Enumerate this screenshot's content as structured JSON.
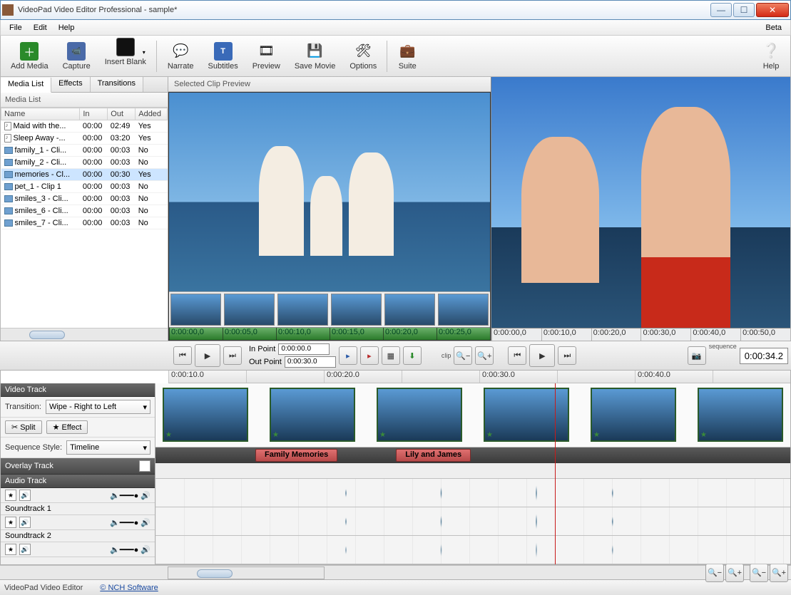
{
  "window": {
    "title": "VideoPad Video Editor Professional - sample*"
  },
  "menubar": {
    "file": "File",
    "edit": "Edit",
    "help": "Help",
    "beta": "Beta"
  },
  "toolbar": {
    "add_media": "Add Media",
    "capture": "Capture",
    "insert_blank": "Insert Blank",
    "narrate": "Narrate",
    "subtitles": "Subtitles",
    "preview": "Preview",
    "save_movie": "Save Movie",
    "options": "Options",
    "suite": "Suite",
    "help": "Help"
  },
  "tabs": {
    "media_list": "Media List",
    "effects": "Effects",
    "transitions": "Transitions"
  },
  "media_list": {
    "title": "Media List",
    "columns": {
      "name": "Name",
      "in": "In",
      "out": "Out",
      "added": "Added"
    },
    "rows": [
      {
        "type": "audio",
        "name": "Maid with the...",
        "in": "00:00",
        "out": "02:49",
        "added": "Yes"
      },
      {
        "type": "audio",
        "name": "Sleep Away -...",
        "in": "00:00",
        "out": "03:20",
        "added": "Yes"
      },
      {
        "type": "clip",
        "name": "family_1 - Cli...",
        "in": "00:00",
        "out": "00:03",
        "added": "No"
      },
      {
        "type": "clip",
        "name": "family_2 - Cli...",
        "in": "00:00",
        "out": "00:03",
        "added": "No"
      },
      {
        "type": "clip",
        "name": "memories - Cl...",
        "in": "00:00",
        "out": "00:30",
        "added": "Yes",
        "selected": true
      },
      {
        "type": "clip",
        "name": "pet_1 - Clip 1",
        "in": "00:00",
        "out": "00:03",
        "added": "No"
      },
      {
        "type": "clip",
        "name": "smiles_3 - Cli...",
        "in": "00:00",
        "out": "00:03",
        "added": "No"
      },
      {
        "type": "clip",
        "name": "smiles_6 - Cli...",
        "in": "00:00",
        "out": "00:03",
        "added": "No"
      },
      {
        "type": "clip",
        "name": "smiles_7 - Cli...",
        "in": "00:00",
        "out": "00:03",
        "added": "No"
      }
    ]
  },
  "clip_preview": {
    "title": "Selected Clip Preview",
    "ruler": [
      "0:00:00,0",
      "0:00:05,0",
      "0:00:10,0",
      "0:00:15,0",
      "0:00:20,0",
      "0:00:25,0"
    ],
    "clip_label": "clip",
    "in_label": "In Point",
    "out_label": "Out Point",
    "in_tc": "0:00:00.0",
    "out_tc": "0:00:30.0"
  },
  "sequence_preview": {
    "ruler": [
      "0:00:00,0",
      "0:00:10,0",
      "0:00:20,0",
      "0:00:30,0",
      "0:00:40,0",
      "0:00:50,0"
    ],
    "label": "sequence",
    "tc": "0:00:34.2"
  },
  "timeline": {
    "ruler": [
      "0:00:10.0",
      "",
      "0:00:20.0",
      "",
      "0:00:30.0",
      "",
      "0:00:40.0",
      ""
    ],
    "video_track": "Video Track",
    "transition_label": "Transition:",
    "transition_value": "Wipe - Right to Left",
    "split": "Split",
    "effect": "Effect",
    "sequence_style_label": "Sequence Style:",
    "sequence_style_value": "Timeline",
    "overlay_track": "Overlay Track",
    "overlay_clips": [
      "Family Memories",
      "Lily and James"
    ],
    "audio_track": "Audio Track",
    "soundtrack1": "Soundtrack 1",
    "soundtrack2": "Soundtrack 2"
  },
  "statusbar": {
    "product": "VideoPad Video Editor",
    "vendor": "© NCH Software"
  }
}
